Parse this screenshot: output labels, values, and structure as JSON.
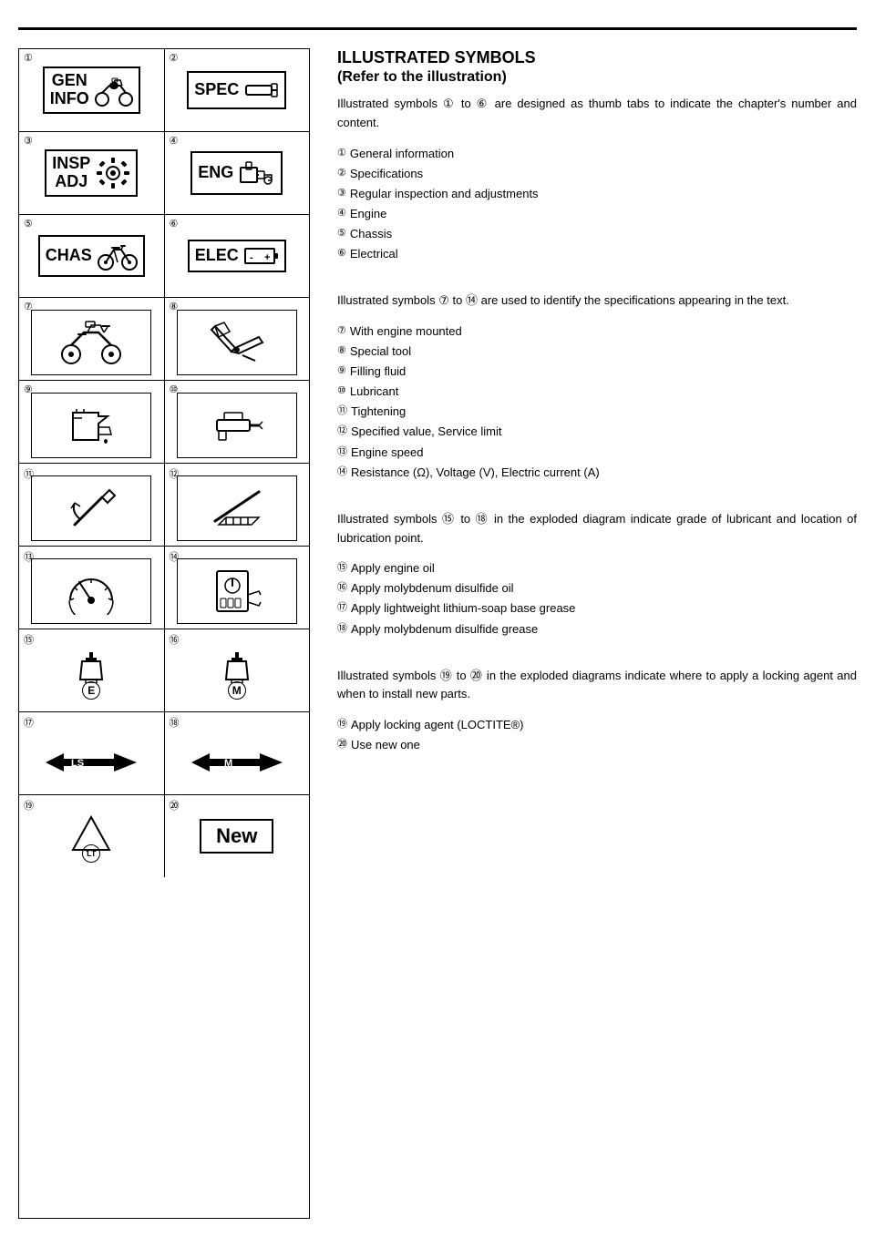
{
  "page": {
    "title": "ILLUSTRATED SYMBOLS",
    "subtitle": "(Refer to the illustration)"
  },
  "intro_text": "Illustrated symbols ① to ⑥ are designed as thumb tabs to indicate the chapter's number and content.",
  "chapters": [
    {
      "num": "①",
      "label": "General information"
    },
    {
      "num": "②",
      "label": "Specifications"
    },
    {
      "num": "③",
      "label": "Regular inspection and adjustments"
    },
    {
      "num": "④",
      "label": "Engine"
    },
    {
      "num": "⑤",
      "label": "Chassis"
    },
    {
      "num": "⑥",
      "label": "Electrical"
    }
  ],
  "specs_intro": "Illustrated symbols ⑦ to ⑭ are used to identify the specifications appearing in the text.",
  "specs": [
    {
      "num": "⑦",
      "label": "With engine mounted"
    },
    {
      "num": "⑧",
      "label": "Special tool"
    },
    {
      "num": "⑨",
      "label": "Filling fluid"
    },
    {
      "num": "⑩",
      "label": "Lubricant"
    },
    {
      "num": "⑪",
      "label": "Tightening"
    },
    {
      "num": "⑫",
      "label": "Specified value, Service limit"
    },
    {
      "num": "⑬",
      "label": "Engine speed"
    },
    {
      "num": "⑭",
      "label": "Resistance (Ω), Voltage (V), Electric current (A)"
    }
  ],
  "lub_intro": "Illustrated symbols ⑮ to ⑱ in the exploded diagram indicate grade of lubricant and location of lubrication point.",
  "lub_items": [
    {
      "num": "⑮",
      "label": "Apply engine oil"
    },
    {
      "num": "⑯",
      "label": "Apply molybdenum disulfide oil"
    },
    {
      "num": "⑰",
      "label": "Apply lightweight lithium-soap base grease"
    },
    {
      "num": "⑱",
      "label": "Apply molybdenum disulfide grease"
    }
  ],
  "new_intro": "Illustrated symbols ⑲ to ⑳ in the exploded diagrams indicate where to apply a locking agent and when to install new parts.",
  "new_items": [
    {
      "num": "⑲",
      "label": "Apply locking agent (LOCTITE®)"
    },
    {
      "num": "⑳",
      "label": "Use new one"
    }
  ],
  "grid": {
    "row1": [
      {
        "num": "①",
        "type": "tab",
        "lines": [
          "GEN",
          "INFO"
        ],
        "icon": "motorcycle"
      },
      {
        "num": "②",
        "type": "tab",
        "lines": [
          "SPEC"
        ],
        "icon": "wrench"
      }
    ],
    "row2": [
      {
        "num": "③",
        "type": "tab",
        "lines": [
          "INSP",
          "ADJ"
        ],
        "icon": "gear"
      },
      {
        "num": "④",
        "type": "tab",
        "lines": [
          "ENG"
        ],
        "icon": "engine"
      }
    ],
    "row3": [
      {
        "num": "⑤",
        "type": "tab",
        "lines": [
          "CHAS"
        ],
        "icon": "bicycle"
      },
      {
        "num": "⑥",
        "type": "tab",
        "lines": [
          "ELEC"
        ],
        "icon": "battery"
      }
    ],
    "row4": [
      {
        "num": "⑦",
        "type": "symbol",
        "icon": "motorcycle2"
      },
      {
        "num": "⑧",
        "type": "symbol",
        "icon": "tools"
      }
    ],
    "row5": [
      {
        "num": "⑨",
        "type": "symbol",
        "icon": "fluid"
      },
      {
        "num": "⑩",
        "type": "symbol",
        "icon": "lubricant"
      }
    ],
    "row6": [
      {
        "num": "⑪",
        "type": "symbol",
        "icon": "tightening"
      },
      {
        "num": "⑫",
        "type": "symbol",
        "icon": "specvalue"
      }
    ],
    "row7": [
      {
        "num": "⑬",
        "type": "symbol",
        "icon": "speedometer"
      },
      {
        "num": "⑭",
        "type": "symbol",
        "icon": "multimeter"
      }
    ],
    "row8": [
      {
        "num": "⑮",
        "type": "lub",
        "code": "E"
      },
      {
        "num": "⑯",
        "type": "lub",
        "code": "M"
      }
    ],
    "row9": [
      {
        "num": "⑰",
        "type": "grease",
        "code": "LS"
      },
      {
        "num": "⑱",
        "type": "grease",
        "code": "M"
      }
    ],
    "row10": [
      {
        "num": "⑲",
        "type": "loctite",
        "code": "LT"
      },
      {
        "num": "⑳",
        "type": "newpart",
        "label": "New"
      }
    ]
  }
}
